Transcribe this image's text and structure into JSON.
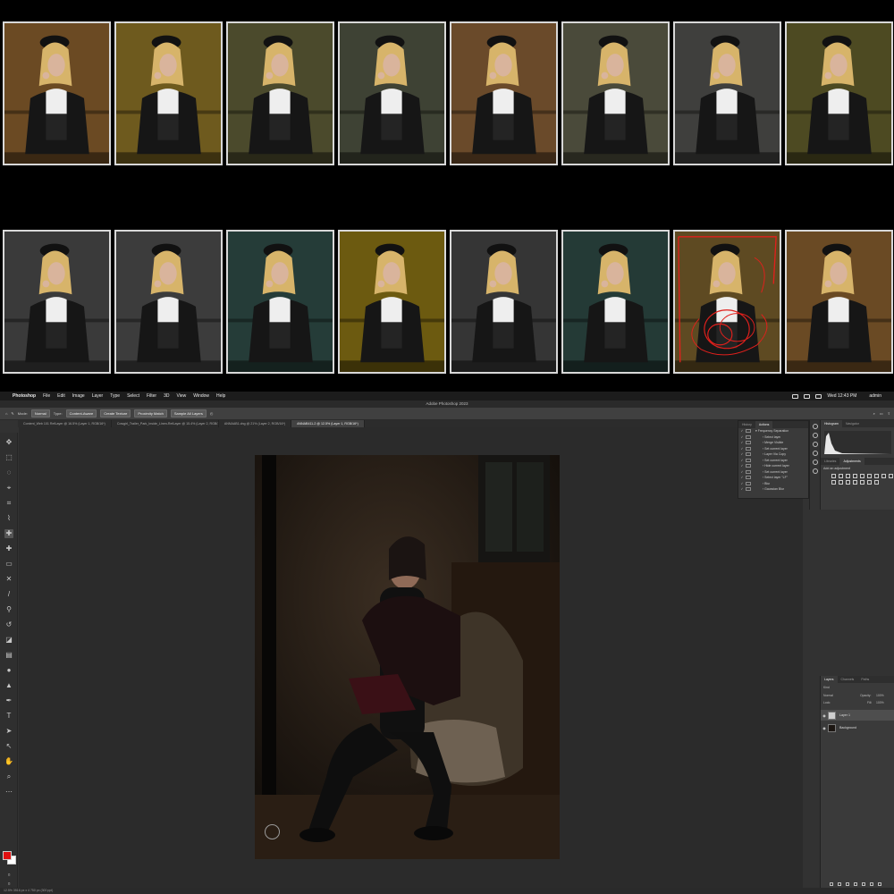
{
  "menubar": {
    "apple": "",
    "app": "Photoshop",
    "items": [
      "File",
      "Edit",
      "Image",
      "Layer",
      "Type",
      "Select",
      "Filter",
      "3D",
      "View",
      "Window",
      "Help"
    ],
    "clock": "Wed 12:43 PM",
    "user": "admin"
  },
  "window": {
    "title": "Adobe Photoshop 2023"
  },
  "options_bar": {
    "mode_label": "Mode:",
    "mode_value": "Normal",
    "type_label": "Type:",
    "content_aware": "Content-Aware",
    "create_texture": "Create Texture",
    "proximity_match": "Proximity Match",
    "sample_all": "Sample All Layers"
  },
  "tabs": [
    {
      "label": "Content_Web 101 RefLayer @ 16.5% (Layer 1, RGB/16*)",
      "active": false
    },
    {
      "label": "Cowgirl_Trailer_Park_Inside_Linen-RefLayer @ 15.4% (Layer 2, RGB/16*)",
      "active": false
    },
    {
      "label": "ANNAAB1.dng @ 21% (Layer 2, RGB/16*)",
      "active": false
    },
    {
      "label": "ANNAB411-2 @ 12.5% (Layer 1, RGB/16*)",
      "active": true
    }
  ],
  "actions_panel": {
    "tabs": [
      "History",
      "Actions"
    ],
    "items": [
      "Frequency Separation",
      "Select layer",
      "Merge Visible",
      "Set current layer",
      "Layer Via Copy",
      "Set current layer",
      "Hide current layer",
      "Set current layer",
      "Select layer \"LF\"",
      "Blur",
      "Gaussian Blur"
    ]
  },
  "histogram_panel": {
    "tabs": [
      "Histogram",
      "Navigator"
    ]
  },
  "adjustments_panel": {
    "tabs": [
      "Libraries",
      "Adjustments"
    ],
    "title": "Add an adjustment"
  },
  "layers_panel": {
    "tabs": [
      "Layers",
      "Channels",
      "Paths"
    ],
    "kind": "Kind",
    "blend": "Normal",
    "opacity_label": "Opacity:",
    "opacity": "100%",
    "lock_label": "Lock:",
    "fill_label": "Fill:",
    "fill": "100%",
    "layers": [
      {
        "name": "Layer 1",
        "selected": true
      },
      {
        "name": "Background",
        "selected": false
      }
    ]
  },
  "status": {
    "text": "12.5%   3516 px x 4 750 px (300 ppi)"
  },
  "colors": {
    "foreground": "#e01010",
    "background": "#ffffff"
  },
  "thumbnails": {
    "row1": [
      "#6b4a23",
      "#6e5a1e",
      "#4b4a2c",
      "#3e4234",
      "#6a4a2a",
      "#4a4a3a",
      "#3f3f3d",
      "#4d4a22"
    ],
    "row2": [
      "#3a3a3a",
      "#3c3c3c",
      "#253c38",
      "#6c5a10",
      "#353535",
      "#243a36",
      "#5e4a22",
      "#6a4a24"
    ]
  }
}
